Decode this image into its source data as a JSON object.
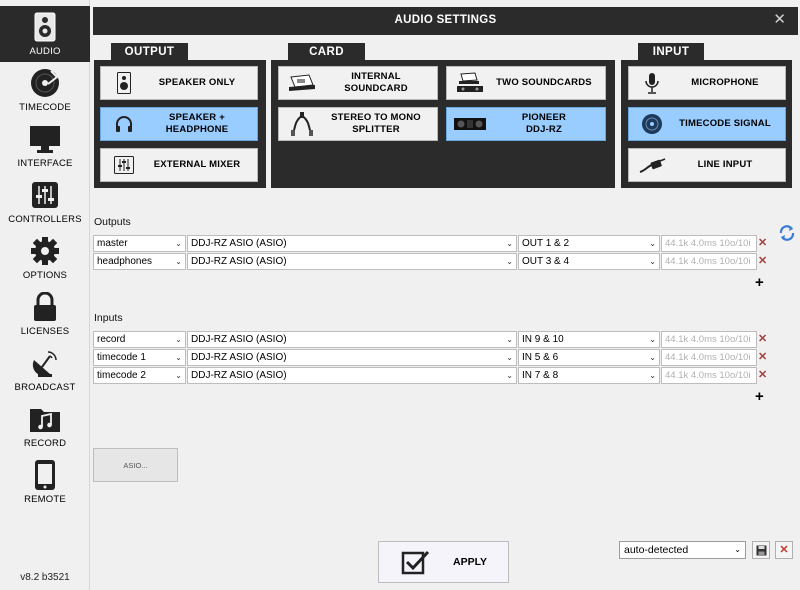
{
  "window": {
    "title": "AUDIO SETTINGS",
    "close": "✕"
  },
  "sidebar": {
    "items": [
      {
        "label": "AUDIO",
        "icon": "speaker-icon"
      },
      {
        "label": "TIMECODE",
        "icon": "vinyl-icon"
      },
      {
        "label": "INTERFACE",
        "icon": "monitor-icon"
      },
      {
        "label": "CONTROLLERS",
        "icon": "sliders-icon"
      },
      {
        "label": "OPTIONS",
        "icon": "gear-icon"
      },
      {
        "label": "LICENSES",
        "icon": "lock-icon"
      },
      {
        "label": "BROADCAST",
        "icon": "satellite-dish-icon"
      },
      {
        "label": "RECORD",
        "icon": "music-folder-icon"
      },
      {
        "label": "REMOTE",
        "icon": "phone-icon"
      }
    ],
    "active": "AUDIO",
    "version": "v8.2 b3521"
  },
  "output": {
    "header": "OUTPUT",
    "options": [
      "SPEAKER ONLY",
      "SPEAKER +\nHEADPHONE",
      "EXTERNAL MIXER"
    ],
    "selected": "SPEAKER +\nHEADPHONE"
  },
  "card": {
    "header": "CARD",
    "options": [
      "INTERNAL\nSOUNDCARD",
      "TWO SOUNDCARDS",
      "STEREO TO MONO\nSPLITTER",
      "PIONEER\nDDJ-RZ"
    ],
    "selected": "PIONEER\nDDJ-RZ"
  },
  "input": {
    "header": "INPUT",
    "options": [
      "MICROPHONE",
      "TIMECODE SIGNAL",
      "LINE INPUT"
    ],
    "selected": "TIMECODE SIGNAL"
  },
  "outputs": {
    "label": "Outputs",
    "rows": [
      {
        "channel": "master",
        "device": "DDJ-RZ ASIO (ASIO)",
        "port": "OUT 1 & 2",
        "info": "44.1k 4.0ms 10o/10i"
      },
      {
        "channel": "headphones",
        "device": "DDJ-RZ ASIO (ASIO)",
        "port": "OUT 3 & 4",
        "info": "44.1k 4.0ms 10o/10i"
      }
    ]
  },
  "inputs": {
    "label": "Inputs",
    "rows": [
      {
        "channel": "record",
        "device": "DDJ-RZ ASIO (ASIO)",
        "port": "IN 9 & 10",
        "info": "44.1k 4.0ms 10o/10i"
      },
      {
        "channel": "timecode 1",
        "device": "DDJ-RZ ASIO (ASIO)",
        "port": "IN 5 & 6",
        "info": "44.1k 4.0ms 10o/10i"
      },
      {
        "channel": "timecode 2",
        "device": "DDJ-RZ ASIO (ASIO)",
        "port": "IN 7 & 8",
        "info": "44.1k 4.0ms 10o/10i"
      }
    ]
  },
  "asio_button": "ASIO...",
  "apply_label": "APPLY",
  "preset": {
    "value": "auto-detected"
  },
  "colors": {
    "dark": "#2b2b2b",
    "selected": "#99ccff",
    "delete": "#a04040"
  }
}
